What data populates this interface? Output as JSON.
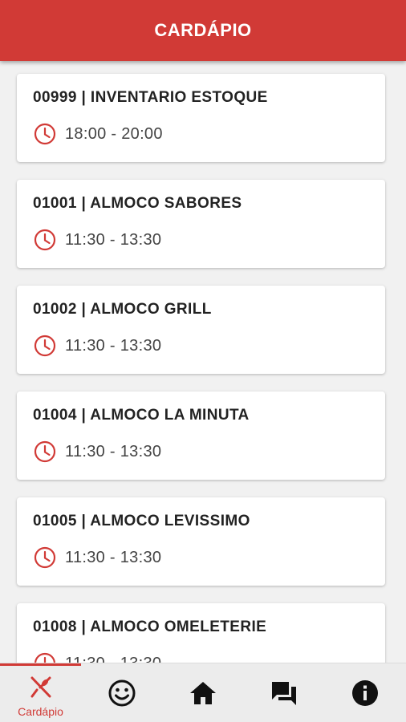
{
  "header": {
    "title": "CARDÁPIO"
  },
  "menus": [
    {
      "title": "00999 | INVENTARIO ESTOQUE",
      "time": "18:00 - 20:00"
    },
    {
      "title": "01001 | ALMOCO SABORES",
      "time": "11:30 - 13:30"
    },
    {
      "title": "01002 | ALMOCO GRILL",
      "time": "11:30 - 13:30"
    },
    {
      "title": "01004 | ALMOCO LA MINUTA",
      "time": "11:30 - 13:30"
    },
    {
      "title": "01005 | ALMOCO LEVISSIMO",
      "time": "11:30 - 13:30"
    },
    {
      "title": "01008 | ALMOCO OMELETERIE",
      "time": "11:30 - 13:30"
    }
  ],
  "bottom_nav": {
    "items": [
      {
        "label": "Cardápio",
        "icon": "fork-knife-icon",
        "active": true
      },
      {
        "label": "",
        "icon": "smiley-icon",
        "active": false
      },
      {
        "label": "",
        "icon": "home-icon",
        "active": false
      },
      {
        "label": "",
        "icon": "chat-icon",
        "active": false
      },
      {
        "label": "",
        "icon": "info-icon",
        "active": false
      }
    ]
  },
  "colors": {
    "primary": "#d13a36",
    "background": "#f1f1f1",
    "card": "#ffffff",
    "nav": "#ececec"
  }
}
